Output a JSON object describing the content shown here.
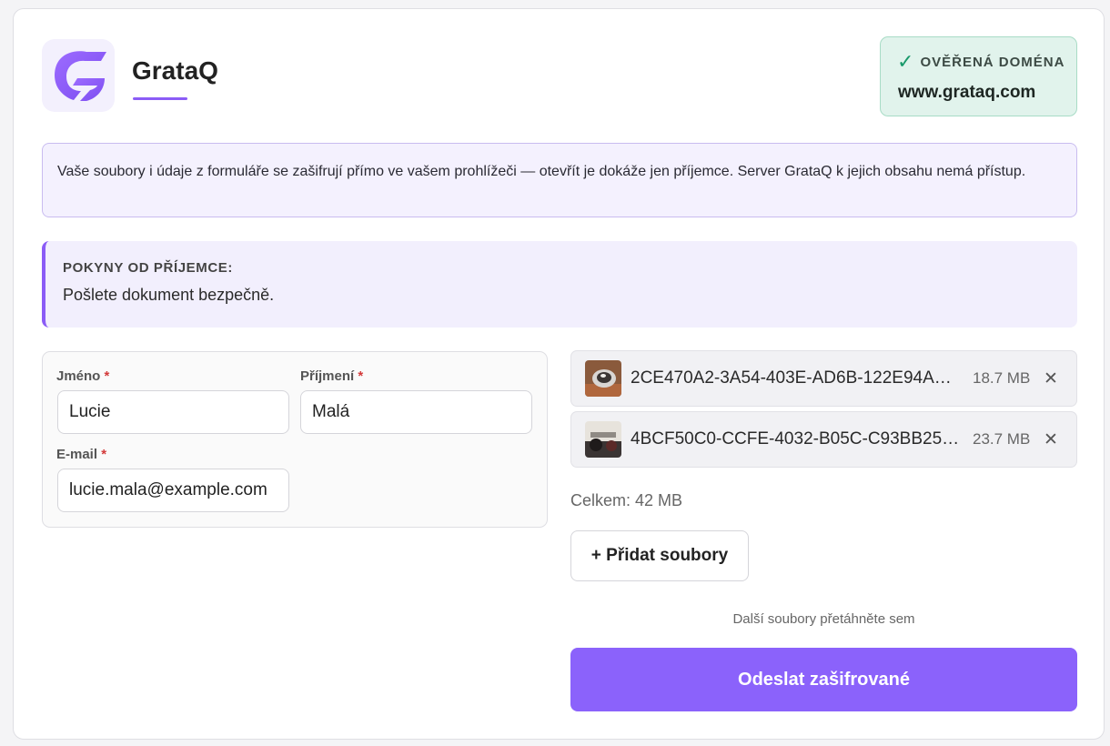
{
  "header": {
    "brand": "GrataQ",
    "domain_badge": {
      "check_glyph": "✓",
      "label": "OVĚŘENÁ DOMÉNA",
      "domain": "www.grataq.com"
    }
  },
  "notice": {
    "text": "Vaše soubory i údaje z formuláře se zašifrují přímo ve vašem prohlížeči — otevřít je dokáže jen příjemce. Server GrataQ k jejich obsahu nemá přístup."
  },
  "instructions": {
    "title": "POKYNY OD PŘÍJEMCE:",
    "body": "Pošlete dokument bezpečně."
  },
  "form": {
    "required_mark": "*",
    "first_name": {
      "label": "Jméno",
      "value": "Lucie"
    },
    "last_name": {
      "label": "Příjmení",
      "value": "Malá"
    },
    "email": {
      "label": "E-mail",
      "value": "lucie.mala@example.com"
    }
  },
  "files": {
    "items": [
      {
        "name": "2CE470A2-3A54-403E-AD6B-122E94AC…",
        "size": "18.7 MB",
        "remove_glyph": "✕",
        "thumb_icon": "photo-thumbnail-icon"
      },
      {
        "name": "4BCF50C0-CCFE-4032-B05C-C93BB253…",
        "size": "23.7 MB",
        "remove_glyph": "✕",
        "thumb_icon": "photo-thumbnail-icon"
      }
    ],
    "total": "Celkem: 42 MB",
    "add_label": "+ Přidat soubory",
    "drop_hint": "Další soubory přetáhněte sem"
  },
  "submit": {
    "label": "Odeslat zašifrované"
  },
  "colors": {
    "accent": "#8b5cf6",
    "submit": "#8b62fb",
    "verified_bg": "#e1f3ec",
    "verified_check": "#18996a",
    "required": "#d33a3a"
  }
}
